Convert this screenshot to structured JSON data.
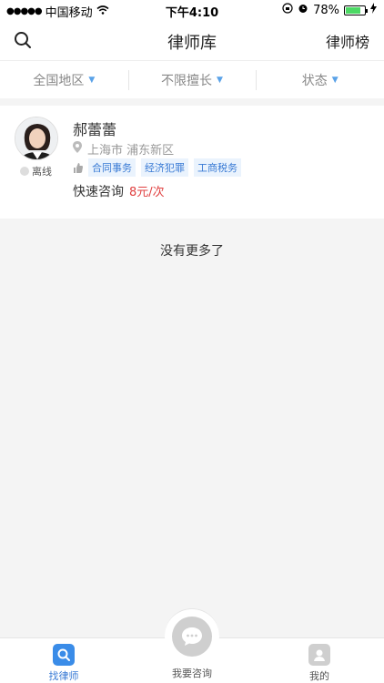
{
  "status_bar": {
    "carrier": "中国移动",
    "time": "下午4:10",
    "battery": "78%",
    "battery_level": 0.78
  },
  "nav": {
    "title": "律师库",
    "right_label": "律师榜"
  },
  "filters": [
    {
      "label": "全国地区"
    },
    {
      "label": "不限擅长"
    },
    {
      "label": "状态"
    }
  ],
  "lawyer": {
    "name": "郝蕾蕾",
    "status": "离线",
    "location": "上海市 浦东新区",
    "tags": [
      "合同事务",
      "经济犯罪",
      "工商税务"
    ],
    "consult_label": "快速咨询",
    "price": "8元/次"
  },
  "footer_note": "没有更多了",
  "tabbar": {
    "tabs": [
      {
        "label": "找律师",
        "active": true
      },
      {
        "label": "我要咨询"
      },
      {
        "label": "我的"
      }
    ]
  }
}
